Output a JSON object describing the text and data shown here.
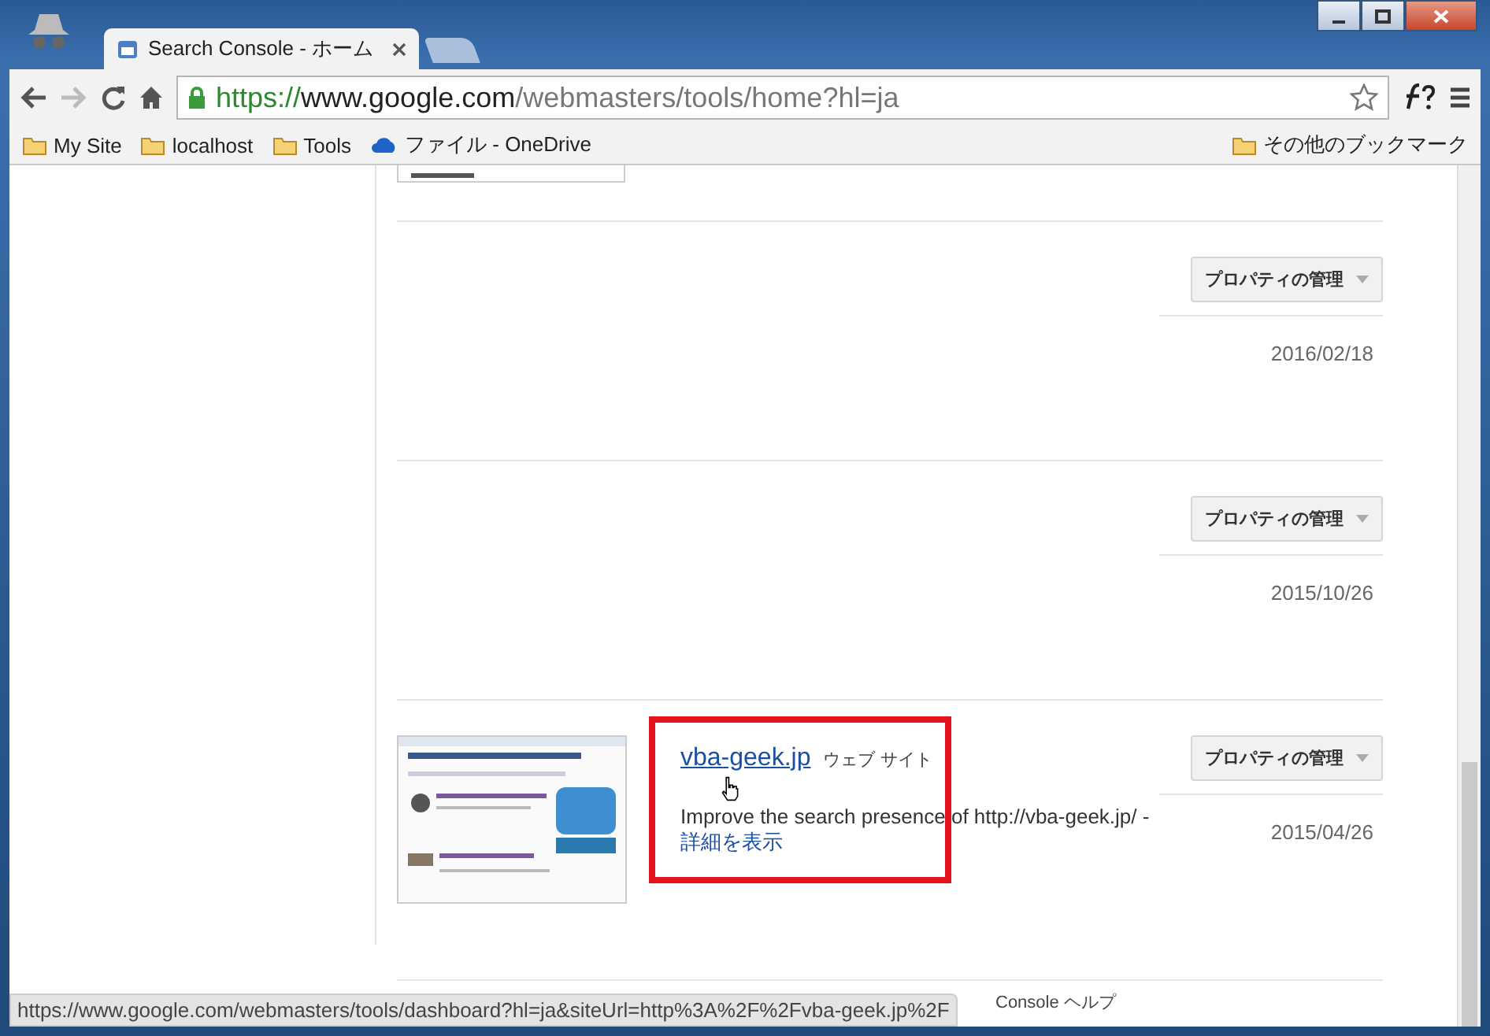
{
  "browser": {
    "tabs": [
      {
        "title": "Search Console - ホーム",
        "selected": true
      }
    ],
    "url": {
      "scheme": "https://",
      "host": "www.google.com",
      "path": "/webmasters/tools/home?hl=ja"
    },
    "bookmarks": [
      {
        "label": "My Site",
        "kind": "folder"
      },
      {
        "label": "localhost",
        "kind": "folder"
      },
      {
        "label": "Tools",
        "kind": "folder"
      },
      {
        "label": "ファイル - OneDrive",
        "kind": "cloud"
      }
    ],
    "other_bookmarks": "その他のブックマーク",
    "status_url": "https://www.google.com/webmasters/tools/dashboard?hl=ja&siteUrl=http%3A%2F%2Fvba-geek.jp%2F"
  },
  "sites": [
    {
      "thumbnail": false,
      "manage_button": "プロパティの管理",
      "date": "2016/02/18"
    },
    {
      "thumbnail": false,
      "manage_button": "プロパティの管理",
      "date": "2015/10/26"
    },
    {
      "thumbnail": true,
      "name": "vba-geek.jp",
      "type": "ウェブ サイト",
      "description": "Improve the search presence of http://vba-geek.jp/ -",
      "details_link": "詳細を表示",
      "manage_button": "プロパティの管理",
      "date": "2015/04/26",
      "highlighted": true
    }
  ],
  "footer": "Console ヘルプ"
}
